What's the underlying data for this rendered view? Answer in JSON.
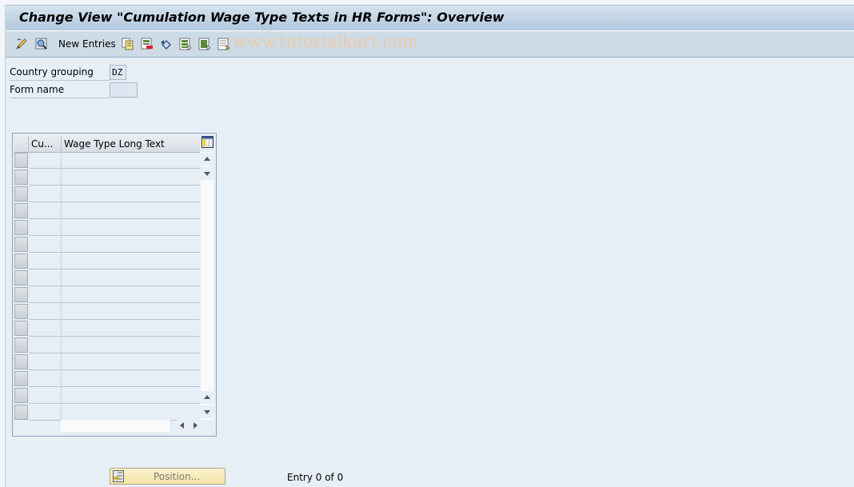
{
  "window": {
    "title": "Change View \"Cumulation Wage Type Texts in HR Forms\": Overview"
  },
  "toolbar": {
    "items": [
      {
        "icon": "display-change-icon"
      },
      {
        "icon": "find-icon"
      },
      {
        "label": "New Entries"
      },
      {
        "icon": "copy-as-icon"
      },
      {
        "icon": "delete-icon"
      },
      {
        "icon": "undo-change-icon"
      },
      {
        "icon": "select-all-icon"
      },
      {
        "icon": "select-block-icon"
      },
      {
        "icon": "deselect-all-icon"
      }
    ],
    "new_entries_label": "New Entries",
    "watermark": "www.tutorialkart.com"
  },
  "fields": {
    "country_grouping": {
      "label": "Country grouping",
      "value": "DZ"
    },
    "form_name": {
      "label": "Form name",
      "value": ""
    }
  },
  "table": {
    "columns": [
      {
        "label": "Cu..."
      },
      {
        "label": "Wage Type Long Text"
      }
    ],
    "visible_rows": 16,
    "rows": []
  },
  "footer": {
    "position_button_label": "Position...",
    "entry_info": "Entry 0 of 0"
  },
  "colors": {
    "title_gradient_top": "#d6e2ee",
    "title_gradient_bottom": "#b2c8dd",
    "toolbar_bg": "#cddbe7",
    "body_bg": "#e6eef6",
    "position_button_bg": "#f3e4a6",
    "watermark": "#f0c8a0"
  }
}
